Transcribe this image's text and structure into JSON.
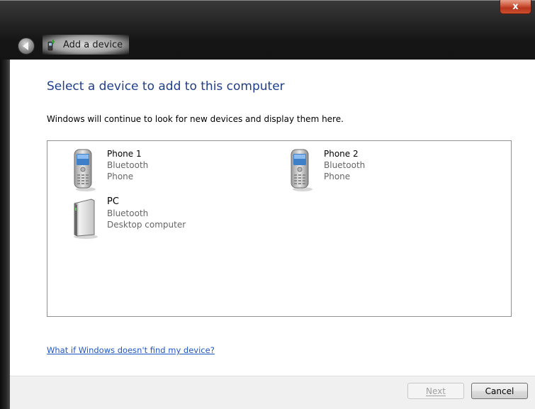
{
  "window": {
    "title": "Add a device",
    "close_glyph": "x"
  },
  "content": {
    "heading": "Select a device to add to this computer",
    "description": "Windows will continue to look for new devices and display them here.",
    "devices": [
      {
        "name": "Phone 1",
        "connection": "Bluetooth",
        "type": "Phone",
        "icon": "phone-icon"
      },
      {
        "name": "Phone 2",
        "connection": "Bluetooth",
        "type": "Phone",
        "icon": "phone-icon"
      },
      {
        "name": "PC",
        "connection": "Bluetooth",
        "type": "Desktop computer",
        "icon": "desktop-computer-icon"
      }
    ],
    "help_link": "What if Windows doesn't find my device?"
  },
  "footer": {
    "next_label": "Next",
    "cancel_label": "Cancel",
    "next_enabled": false
  },
  "colors": {
    "heading": "#1e3e8a",
    "link": "#1f56c5",
    "close_button": "#c9502f"
  }
}
